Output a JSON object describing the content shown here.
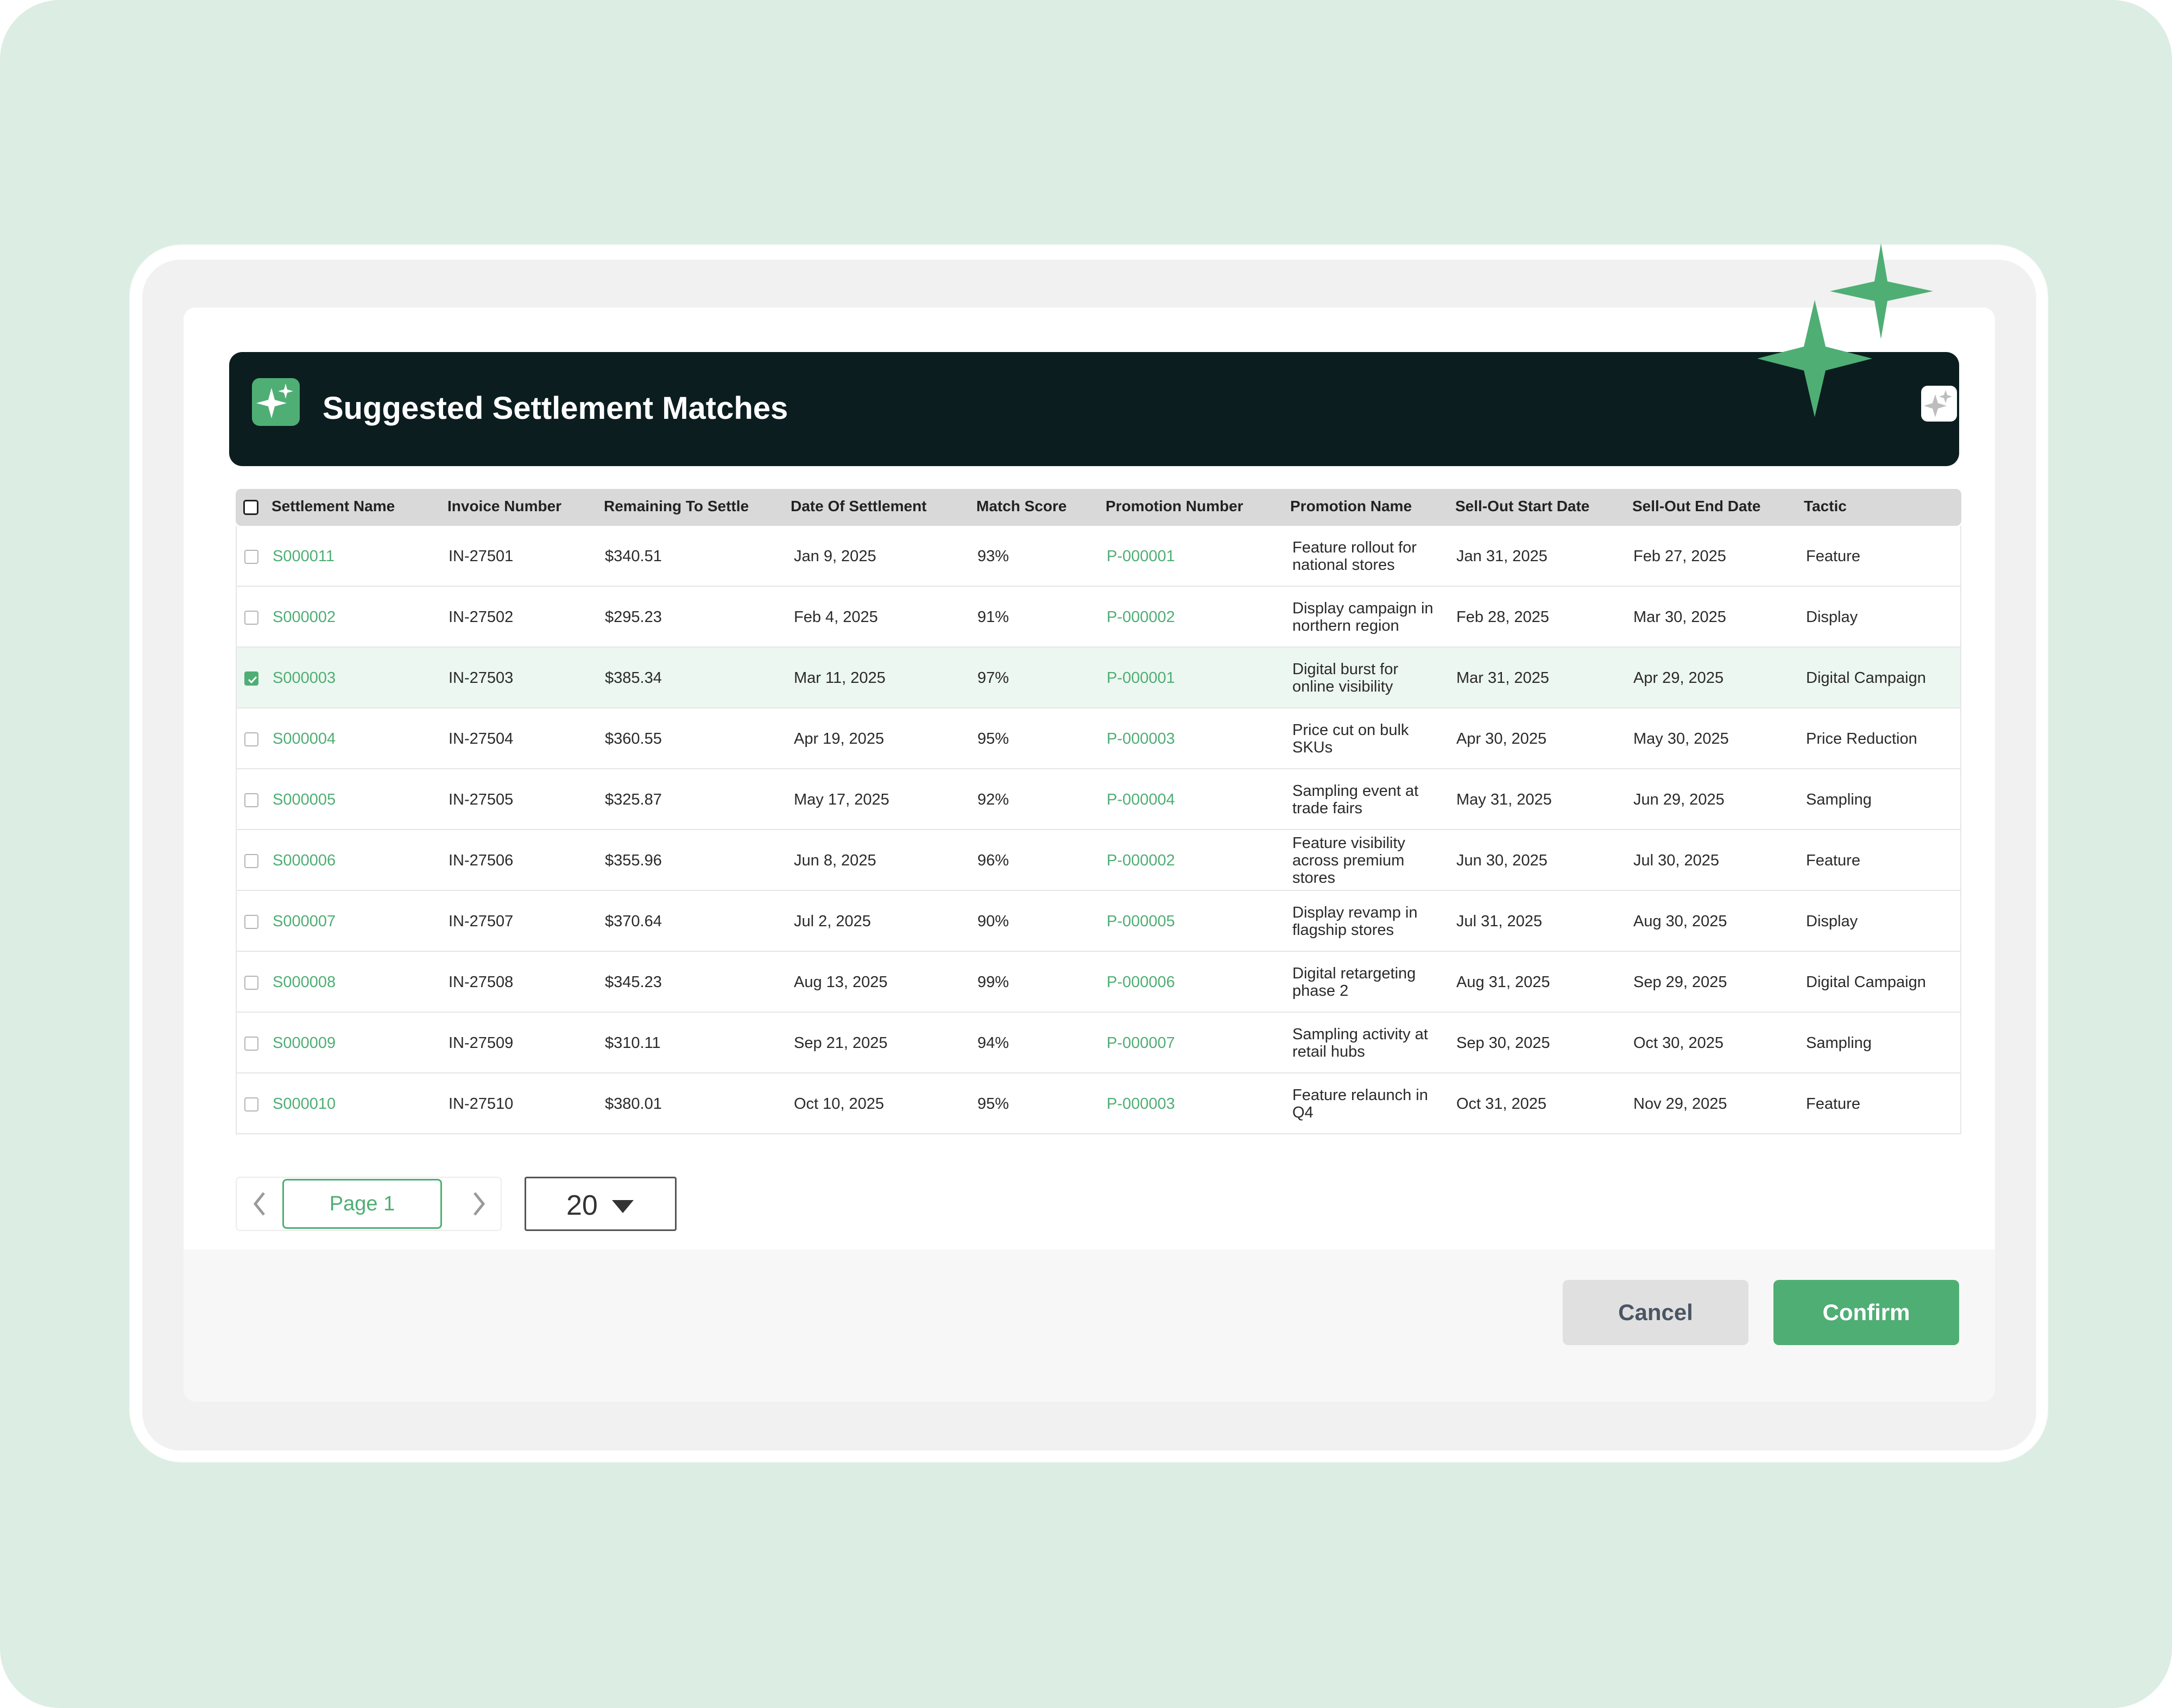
{
  "dialog": {
    "title": "Suggested Settlement Matches",
    "accent_color": "#4fae74",
    "header_color": "#0b1d1f",
    "header_icon": "sparkles-icon",
    "header_action_icon": "sparkles-icon"
  },
  "table": {
    "headers": {
      "settlement_name": "Settlement Name",
      "invoice_number": "Invoice Number",
      "remaining": "Remaining To Settle",
      "date": "Date Of Settlement",
      "score": "Match Score",
      "promo_number": "Promotion Number",
      "promo_name": "Promotion Name",
      "start": "Sell-Out Start Date",
      "end": "Sell-Out End Date",
      "tactic": "Tactic"
    },
    "rows": [
      {
        "selected": false,
        "settlement_name": "S000011",
        "invoice_number": "IN-27501",
        "remaining": "$340.51",
        "date": "Jan 9, 2025",
        "score": "93%",
        "promo_number": "P-000001",
        "promo_name": "Feature rollout for national stores",
        "start": "Jan 31, 2025",
        "end": "Feb 27, 2025",
        "tactic": "Feature"
      },
      {
        "selected": false,
        "settlement_name": "S000002",
        "invoice_number": "IN-27502",
        "remaining": "$295.23",
        "date": "Feb 4, 2025",
        "score": "91%",
        "promo_number": "P-000002",
        "promo_name": "Display campaign in northern region",
        "start": "Feb 28, 2025",
        "end": "Mar 30, 2025",
        "tactic": "Display"
      },
      {
        "selected": true,
        "settlement_name": "S000003",
        "invoice_number": "IN-27503",
        "remaining": "$385.34",
        "date": "Mar 11, 2025",
        "score": "97%",
        "promo_number": "P-000001",
        "promo_name": "Digital burst for online visibility",
        "start": "Mar 31, 2025",
        "end": "Apr 29, 2025",
        "tactic": "Digital Campaign"
      },
      {
        "selected": false,
        "settlement_name": "S000004",
        "invoice_number": "IN-27504",
        "remaining": "$360.55",
        "date": "Apr 19, 2025",
        "score": "95%",
        "promo_number": "P-000003",
        "promo_name": "Price cut on bulk SKUs",
        "start": "Apr 30, 2025",
        "end": "May 30, 2025",
        "tactic": "Price Reduction"
      },
      {
        "selected": false,
        "settlement_name": "S000005",
        "invoice_number": "IN-27505",
        "remaining": "$325.87",
        "date": "May 17, 2025",
        "score": "92%",
        "promo_number": "P-000004",
        "promo_name": "Sampling event at trade fairs",
        "start": "May 31, 2025",
        "end": "Jun 29, 2025",
        "tactic": "Sampling"
      },
      {
        "selected": false,
        "settlement_name": "S000006",
        "invoice_number": "IN-27506",
        "remaining": "$355.96",
        "date": "Jun 8, 2025",
        "score": "96%",
        "promo_number": "P-000002",
        "promo_name": "Feature visibility across premium stores",
        "start": "Jun 30, 2025",
        "end": "Jul 30, 2025",
        "tactic": "Feature"
      },
      {
        "selected": false,
        "settlement_name": "S000007",
        "invoice_number": "IN-27507",
        "remaining": "$370.64",
        "date": "Jul 2, 2025",
        "score": "90%",
        "promo_number": "P-000005",
        "promo_name": "Display revamp in flagship stores",
        "start": "Jul 31, 2025",
        "end": "Aug 30, 2025",
        "tactic": "Display"
      },
      {
        "selected": false,
        "settlement_name": "S000008",
        "invoice_number": "IN-27508",
        "remaining": "$345.23",
        "date": "Aug 13, 2025",
        "score": "99%",
        "promo_number": "P-000006",
        "promo_name": "Digital retargeting phase 2",
        "start": "Aug 31, 2025",
        "end": "Sep 29, 2025",
        "tactic": "Digital Campaign"
      },
      {
        "selected": false,
        "settlement_name": "S000009",
        "invoice_number": "IN-27509",
        "remaining": "$310.11",
        "date": "Sep 21, 2025",
        "score": "94%",
        "promo_number": "P-000007",
        "promo_name": "Sampling activity at retail hubs",
        "start": "Sep 30, 2025",
        "end": "Oct 30, 2025",
        "tactic": "Sampling"
      },
      {
        "selected": false,
        "settlement_name": "S000010",
        "invoice_number": "IN-27510",
        "remaining": "$380.01",
        "date": "Oct 10, 2025",
        "score": "95%",
        "promo_number": "P-000003",
        "promo_name": "Feature relaunch in Q4",
        "start": "Oct 31, 2025",
        "end": "Nov 29, 2025",
        "tactic": "Feature"
      }
    ]
  },
  "pagination": {
    "page_label": "Page 1",
    "page_size": "20",
    "prev_icon": "chevron-left-icon",
    "next_icon": "chevron-right-icon"
  },
  "actions": {
    "cancel_label": "Cancel",
    "confirm_label": "Confirm"
  }
}
